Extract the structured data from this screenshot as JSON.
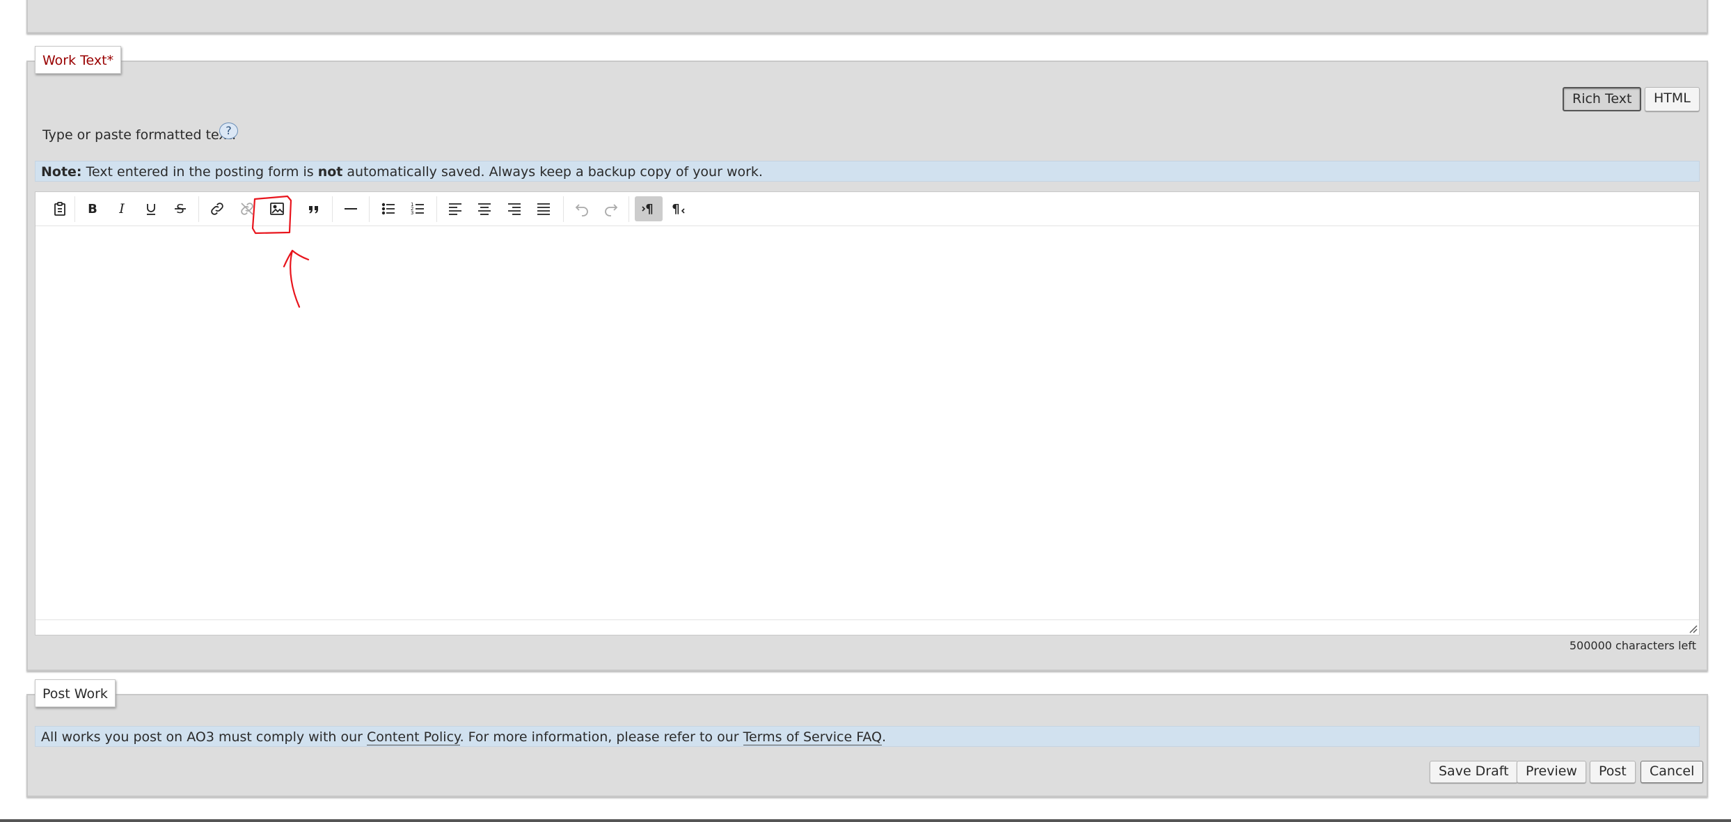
{
  "work_text": {
    "legend": "Work Text",
    "required_mark": "*",
    "mode_rich": "Rich Text",
    "mode_html": "HTML",
    "hint": "Type or paste formatted text.",
    "help": "?",
    "note_label": "Note:",
    "note_part1": " Text entered in the posting form is ",
    "note_bold": "not",
    "note_part2": " automatically saved. Always keep a backup copy of your work.",
    "chars_left": "500000 characters left"
  },
  "toolbar": {
    "icons": [
      "paste-icon",
      "bold-icon",
      "italic-icon",
      "underline-icon",
      "strikethrough-icon",
      "link-icon",
      "unlink-icon",
      "image-icon",
      "blockquote-icon",
      "horizontal-rule-icon",
      "bullet-list-icon",
      "numbered-list-icon",
      "align-left-icon",
      "align-center-icon",
      "align-right-icon",
      "justify-icon",
      "undo-icon",
      "redo-icon",
      "ltr-icon",
      "rtl-icon"
    ]
  },
  "post_work": {
    "legend": "Post Work",
    "notice_part1": "All works you post on AO3 must comply with our ",
    "content_policy": "Content Policy",
    "notice_part2": ". For more information, please refer to our ",
    "tos_faq": "Terms of Service FAQ",
    "notice_part3": ".",
    "save_draft": "Save Draft",
    "preview": "Preview",
    "post": "Post",
    "cancel": "Cancel"
  },
  "colors": {
    "fieldset_bg": "#dddddd",
    "note_bg": "#d1e1ef",
    "legend_red": "#990000",
    "annotation_red": "#e8141c"
  }
}
